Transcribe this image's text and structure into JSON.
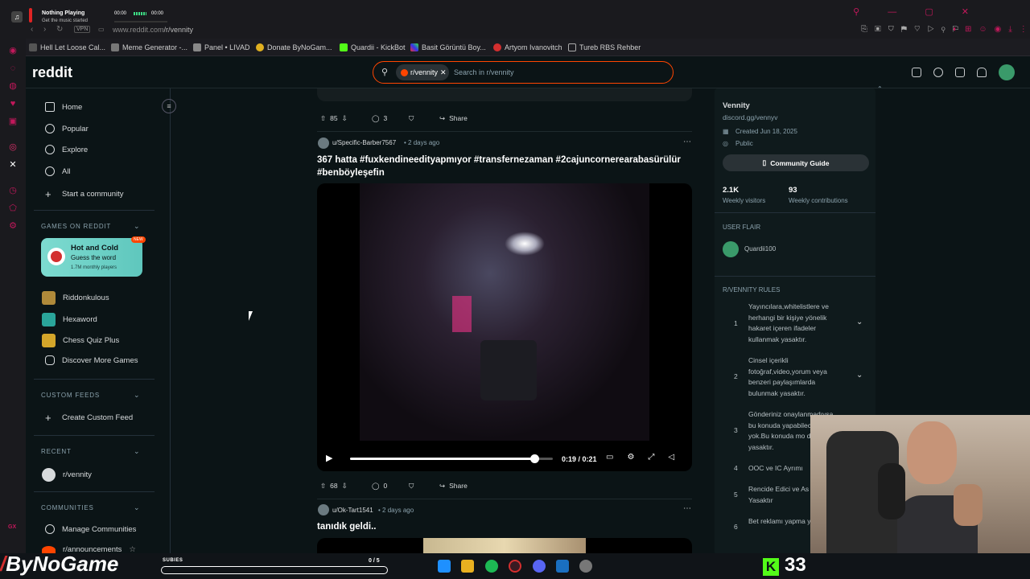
{
  "music": {
    "title": "Nothing Playing",
    "subtitle": "Get the music started",
    "time_left": "00:00",
    "time_right": "00:00"
  },
  "browser": {
    "url_prefix": "www.reddit.com",
    "url_path": "/r/vennity"
  },
  "bookmarks": [
    "Hell Let Loose Cal...",
    "Meme Generator -...",
    "Panel • LIVAD",
    "Donate ByNoGam...",
    "Quardii - KickBot",
    "Basit Görüntü Boy...",
    "Artyom Ivanovitch",
    "Tureb RBS Rehber"
  ],
  "header": {
    "logo": "reddit",
    "chip": "r/vennity",
    "search_placeholder": "Search in r/vennity"
  },
  "sidebar": {
    "nav": [
      "Home",
      "Popular",
      "Explore",
      "All",
      "Start a community"
    ],
    "games_header": "GAMES ON REDDIT",
    "featured_game": {
      "title": "Hot and Cold",
      "subtitle": "Guess the word",
      "players": "1.7M monthly players",
      "badge": "NEW"
    },
    "games": [
      "Riddonkulous",
      "Hexaword",
      "Chess Quiz Plus",
      "Discover More Games"
    ],
    "custom_feeds_header": "CUSTOM FEEDS",
    "create_custom_feed": "Create Custom Feed",
    "recent_header": "RECENT",
    "recent": [
      "r/vennity"
    ],
    "communities_header": "COMMUNITIES",
    "manage_communities": "Manage Communities",
    "announcements": "r/announcements"
  },
  "posts": [
    {
      "votes": "85",
      "comments": "3",
      "share": "Share"
    },
    {
      "author": "u/Specific-Barber7567",
      "age": "• 2 days ago",
      "title": "367 hatta #fuxkendineedityapmıyor #transfernezaman #2cajuncornerearabasürülür #benböyleşefin",
      "video_time": "0:19 / 0:21",
      "video_progress": 0.91,
      "votes": "68",
      "comments": "0",
      "share": "Share"
    },
    {
      "author": "u/Ok-Tart1541",
      "age": "• 2 days ago",
      "title": "tanıdık geldi.."
    }
  ],
  "community": {
    "name": "Vennity",
    "link": "discord.gg/vennyv",
    "created": "Created Jun 18, 2025",
    "visibility": "Public",
    "guide_button": "Community Guide",
    "visitors": "2.1K",
    "visitors_label": "Weekly visitors",
    "contributions": "93",
    "contributions_label": "Weekly contributions",
    "flair_header": "USER FLAIR",
    "flair_user": "Quardii100",
    "rules_header": "R/VENNITY RULES",
    "rules": [
      {
        "n": "1",
        "text": "Yayıncılara,whitelistlere ve herhangi bir kişiye yönelik hakaret içeren ifadeler kullanmak yasaktır."
      },
      {
        "n": "2",
        "text": "Cinsel içerikli fotoğraf,video,yorum veya benzeri paylaşımlarda bulunmak yasaktır."
      },
      {
        "n": "3",
        "text": "Gönderiniz onaylanmadıysa bu konuda yapabilecek yok.Bu konuda mo darlamak yasaktır."
      },
      {
        "n": "4",
        "text": "OOC ve IC Ayrımı"
      },
      {
        "n": "5",
        "text": "Rencide Edici ve As İçerik Yasaktır"
      },
      {
        "n": "6",
        "text": "Bet reklamı yapma yasaktır."
      }
    ]
  },
  "overlay": {
    "brand": "ByNoGame",
    "subs_label": "SUBIES",
    "subs_count": "0 / 5",
    "kick_count": "33"
  },
  "colors": {
    "accent": "#ff4500",
    "bg": "#0b1416",
    "opera": "#c2185b",
    "kick": "#53fc18"
  }
}
